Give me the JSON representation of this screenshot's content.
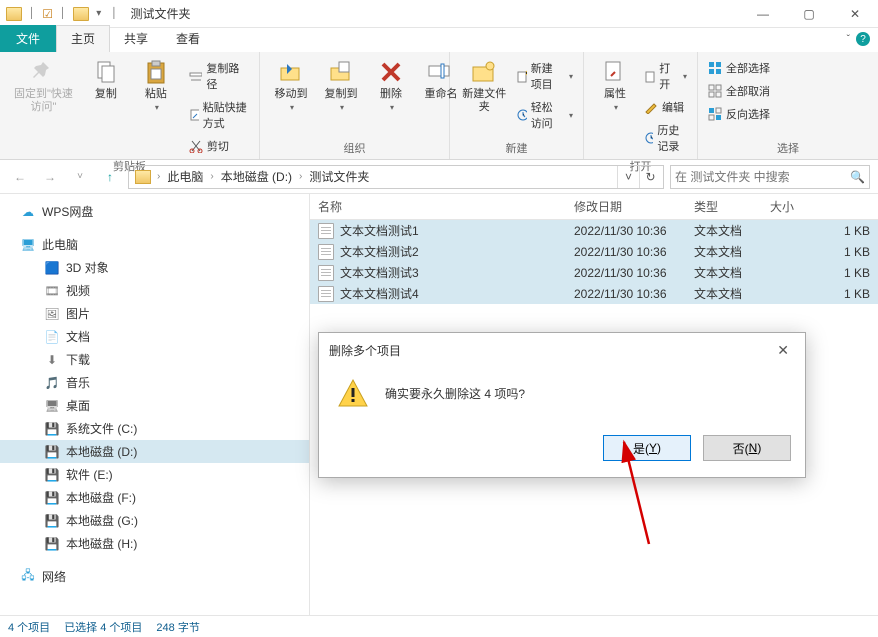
{
  "window": {
    "title": "测试文件夹"
  },
  "tabs": {
    "file": "文件",
    "home": "主页",
    "share": "共享",
    "view": "查看"
  },
  "ribbon": {
    "pin": "固定到\"快速访问\"",
    "copy": "复制",
    "paste": "粘贴",
    "copy_path": "复制路径",
    "paste_shortcut": "粘贴快捷方式",
    "cut": "剪切",
    "clipboard_group": "剪贴板",
    "move_to": "移动到",
    "copy_to": "复制到",
    "delete": "删除",
    "rename": "重命名",
    "organize_group": "组织",
    "new_folder": "新建文件夹",
    "new_item": "新建项目",
    "easy_access": "轻松访问",
    "new_group": "新建",
    "properties": "属性",
    "open": "打开",
    "edit": "编辑",
    "history": "历史记录",
    "open_group": "打开",
    "select_all": "全部选择",
    "select_none": "全部取消",
    "invert_selection": "反向选择",
    "select_group": "选择"
  },
  "breadcrumb": {
    "pc": "此电脑",
    "drive": "本地磁盘 (D:)",
    "folder": "测试文件夹"
  },
  "search": {
    "placeholder": "在 测试文件夹 中搜索"
  },
  "sidebar": {
    "wps": "WPS网盘",
    "this_pc": "此电脑",
    "items": [
      "3D 对象",
      "视频",
      "图片",
      "文档",
      "下载",
      "音乐",
      "桌面",
      "系统文件 (C:)",
      "本地磁盘 (D:)",
      "软件 (E:)",
      "本地磁盘 (F:)",
      "本地磁盘 (G:)",
      "本地磁盘 (H:)"
    ],
    "network": "网络"
  },
  "list": {
    "columns": {
      "name": "名称",
      "date": "修改日期",
      "type": "类型",
      "size": "大小"
    },
    "rows": [
      {
        "name": "文本文档测试1",
        "date": "2022/11/30 10:36",
        "type": "文本文档",
        "size": "1 KB"
      },
      {
        "name": "文本文档测试2",
        "date": "2022/11/30 10:36",
        "type": "文本文档",
        "size": "1 KB"
      },
      {
        "name": "文本文档测试3",
        "date": "2022/11/30 10:36",
        "type": "文本文档",
        "size": "1 KB"
      },
      {
        "name": "文本文档测试4",
        "date": "2022/11/30 10:36",
        "type": "文本文档",
        "size": "1 KB"
      }
    ]
  },
  "status": {
    "items": "4 个项目",
    "selected": "已选择 4 个项目",
    "bytes": "248 字节"
  },
  "dialog": {
    "title": "删除多个项目",
    "message": "确实要永久删除这 4 项吗?",
    "yes_prefix": "是(",
    "yes_key": "Y",
    "yes_suffix": ")",
    "no_prefix": "否(",
    "no_key": "N",
    "no_suffix": ")"
  }
}
